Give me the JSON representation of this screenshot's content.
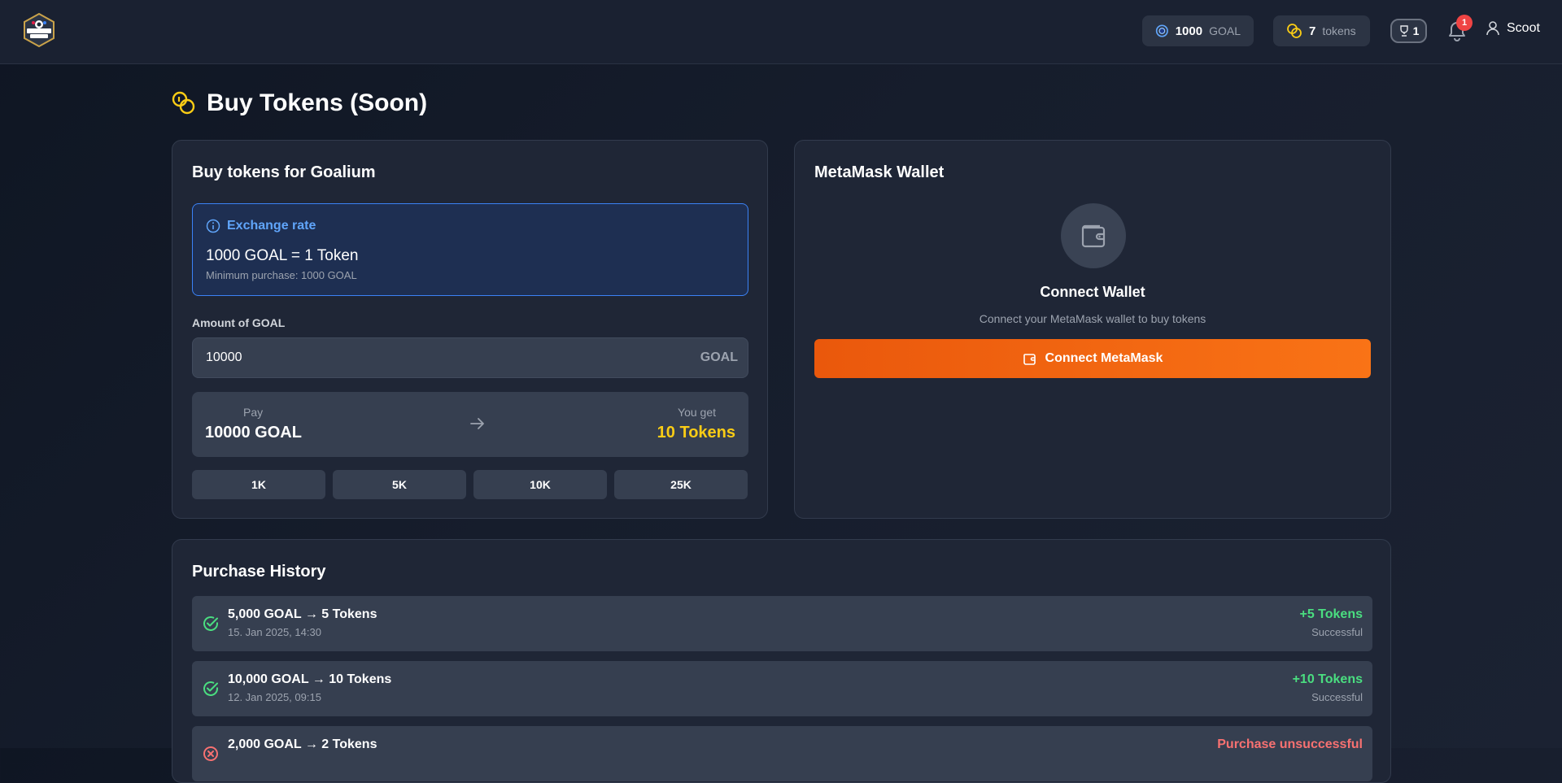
{
  "header": {
    "logo_alt": "Crypto Goal",
    "goal_balance": "1000",
    "goal_unit": "GOAL",
    "tokens_balance": "7",
    "tokens_unit": "tokens",
    "badge_count": "1",
    "notification_count": "1",
    "username": "Scoot"
  },
  "page": {
    "title": "Buy Tokens (Soon)"
  },
  "buy_card": {
    "title": "Buy tokens for Goalium",
    "exchange_label": "Exchange rate",
    "exchange_rate": "1000 GOAL = 1 Token",
    "minimum": "Minimum purchase: 1000 GOAL",
    "amount_label": "Amount of GOAL",
    "amount_value": "10000",
    "amount_suffix": "GOAL",
    "pay_label": "Pay",
    "pay_value": "10000 GOAL",
    "get_label": "You get",
    "get_value": "10 Tokens",
    "quick_amounts": [
      "1K",
      "5K",
      "10K",
      "25K"
    ]
  },
  "wallet_card": {
    "title": "MetaMask Wallet",
    "connect_title": "Connect Wallet",
    "connect_sub": "Connect your MetaMask wallet to buy tokens",
    "connect_button": "Connect MetaMask"
  },
  "history": {
    "title": "Purchase History",
    "rows": [
      {
        "main": "5,000 GOAL → 5 Tokens",
        "date": "15. Jan 2025, 14:30",
        "amount": "+5 Tokens",
        "status": "Successful"
      },
      {
        "main": "10,000 GOAL → 10 Tokens",
        "date": "12. Jan 2025, 09:15",
        "amount": "+10 Tokens",
        "status": "Successful"
      },
      {
        "main": "2,000 GOAL → 2 Tokens",
        "date": "",
        "amount": "Purchase unsuccessful",
        "status": ""
      }
    ]
  },
  "colors": {
    "accent_orange": "#f97316",
    "accent_blue": "#3b82f6",
    "token_yellow": "#facc15",
    "success_green": "#4ade80",
    "error_red": "#f87171"
  }
}
